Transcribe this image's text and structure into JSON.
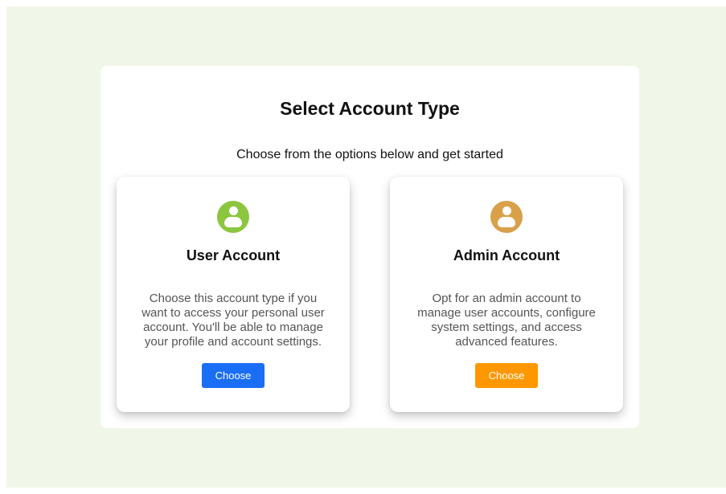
{
  "page": {
    "title": "Select Account Type",
    "subtitle": "Choose from the options below and get started"
  },
  "cards": [
    {
      "icon": "user-icon",
      "icon_color": "#8cc63f",
      "title": "User Account",
      "description": "Choose this account type if you want to access your personal user account. You'll be able to manage your profile and account settings.",
      "button_label": "Choose",
      "button_color": "#1a6ef5"
    },
    {
      "icon": "user-icon",
      "icon_color": "#d9a04a",
      "title": "Admin Account",
      "description": "Opt for an admin account to manage user accounts, configure system settings, and access advanced features.",
      "button_label": "Choose",
      "button_color": "#ff9800"
    }
  ],
  "colors": {
    "background": "#f1f7e8",
    "panel": "#ffffff"
  }
}
